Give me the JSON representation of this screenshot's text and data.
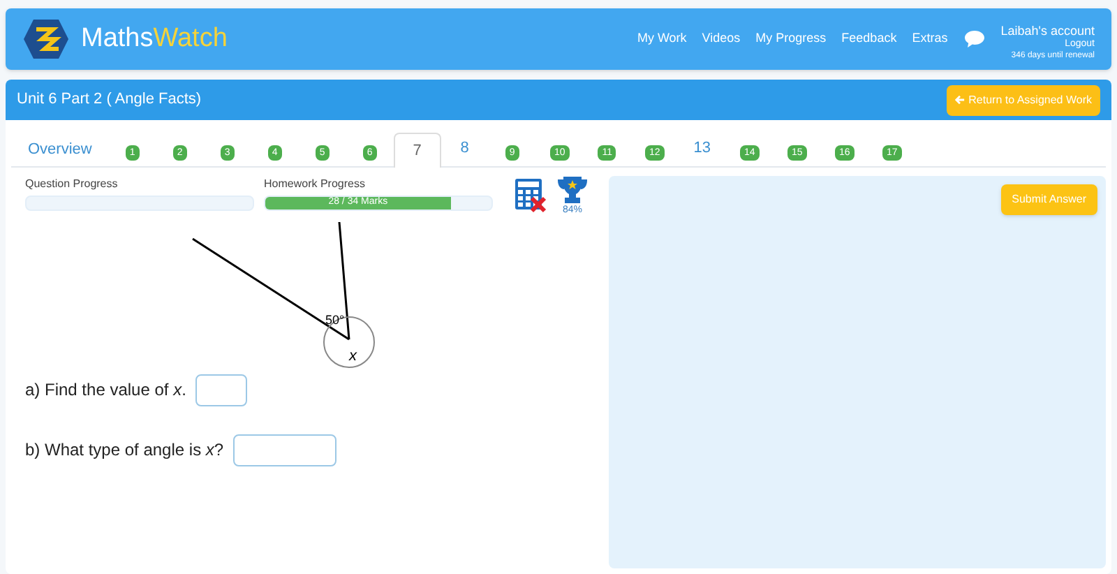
{
  "brand": {
    "first": "Maths",
    "second": "Watch"
  },
  "nav": [
    "My Work",
    "Videos",
    "My Progress",
    "Feedback",
    "Extras"
  ],
  "account": {
    "name": "Laibah's account",
    "logout": "Logout",
    "renewal": "346 days until renewal"
  },
  "unit_title": "Unit 6 Part 2 ( Angle Facts)",
  "return_button": "Return to Assigned Work",
  "tabs": [
    {
      "label": "Overview",
      "kind": "link",
      "selected": false
    },
    {
      "label": "1",
      "kind": "done",
      "selected": false
    },
    {
      "label": "2",
      "kind": "done",
      "selected": false
    },
    {
      "label": "3",
      "kind": "done",
      "selected": false
    },
    {
      "label": "4",
      "kind": "done",
      "selected": false
    },
    {
      "label": "5",
      "kind": "done",
      "selected": false
    },
    {
      "label": "6",
      "kind": "done",
      "selected": false
    },
    {
      "label": "7",
      "kind": "open",
      "selected": true
    },
    {
      "label": "8",
      "kind": "open",
      "selected": false
    },
    {
      "label": "9",
      "kind": "done",
      "selected": false
    },
    {
      "label": "10",
      "kind": "done",
      "selected": false
    },
    {
      "label": "11",
      "kind": "done",
      "selected": false
    },
    {
      "label": "12",
      "kind": "done",
      "selected": false
    },
    {
      "label": "13",
      "kind": "open",
      "selected": false
    },
    {
      "label": "14",
      "kind": "done",
      "selected": false
    },
    {
      "label": "15",
      "kind": "done",
      "selected": false
    },
    {
      "label": "16",
      "kind": "done",
      "selected": false
    },
    {
      "label": "17",
      "kind": "done",
      "selected": false
    }
  ],
  "question_progress": {
    "label": "Question Progress",
    "level": 0
  },
  "homework_progress": {
    "label": "Homework Progress",
    "level": 0.82,
    "reading": "28 / 34 Marks"
  },
  "calculator_allowed": false,
  "score": "84%",
  "diagram": {
    "angle": "50°",
    "unknown": "x"
  },
  "questions": [
    "a) Find the value of *x*.",
    "b) What type of angle is *x*?"
  ],
  "submit_button": "Submit Answer"
}
